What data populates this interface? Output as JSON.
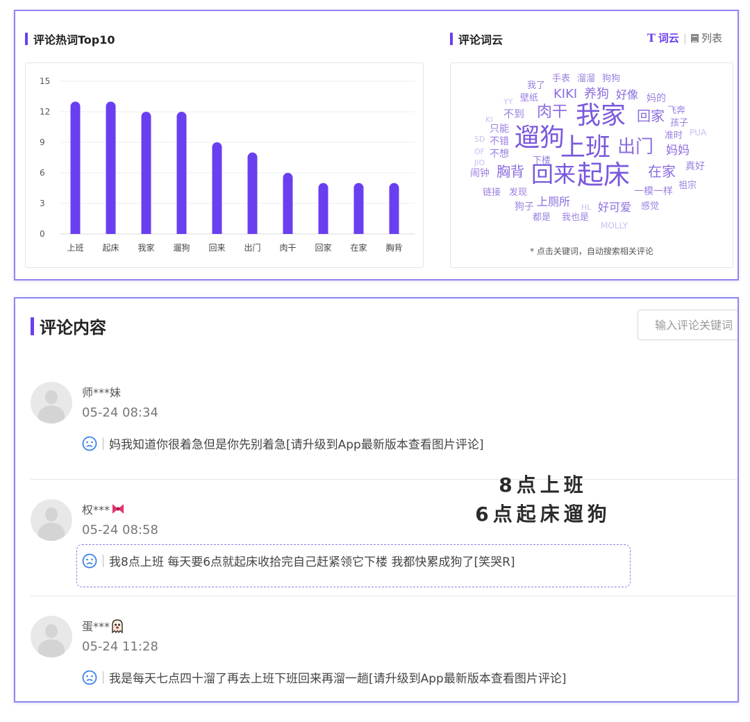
{
  "hot_words": {
    "title": "评论热词Top10"
  },
  "word_cloud": {
    "title": "评论词云",
    "toggle": {
      "cloud_label": "词云",
      "list_label": "列表"
    },
    "note": "* 点击关键词，自动搜索相关评论",
    "words": [
      {
        "text": "我了",
        "size": 13,
        "color": "#9b7fe0"
      },
      {
        "text": "手表",
        "size": 13,
        "color": "#9b7fe0"
      },
      {
        "text": "溜溜",
        "size": 13,
        "color": "#9b7fe0"
      },
      {
        "text": "狗狗",
        "size": 13,
        "color": "#9b7fe0"
      },
      {
        "text": "YY",
        "size": 11,
        "color": "#c9bff2"
      },
      {
        "text": "壁纸",
        "size": 13,
        "color": "#9b7fe0"
      },
      {
        "text": "KIKI",
        "size": 18,
        "color": "#8b6ce0"
      },
      {
        "text": "养狗",
        "size": 18,
        "color": "#8b6ce0"
      },
      {
        "text": "好像",
        "size": 16,
        "color": "#8b6ce0"
      },
      {
        "text": "妈的",
        "size": 14,
        "color": "#9b7fe0"
      },
      {
        "text": "不到",
        "size": 15,
        "color": "#9b7fe0"
      },
      {
        "text": "肉干",
        "size": 22,
        "color": "#8b6ce0"
      },
      {
        "text": "我家",
        "size": 36,
        "color": "#7a58dc"
      },
      {
        "text": "回家",
        "size": 20,
        "color": "#8b6ce0"
      },
      {
        "text": "飞奔",
        "size": 13,
        "color": "#9b7fe0"
      },
      {
        "text": "KI",
        "size": 11,
        "color": "#c9bff2"
      },
      {
        "text": "孩子",
        "size": 13,
        "color": "#9b7fe0"
      },
      {
        "text": "只能",
        "size": 14,
        "color": "#9b7fe0"
      },
      {
        "text": "准时",
        "size": 13,
        "color": "#9b7fe0"
      },
      {
        "text": "PUA",
        "size": 12,
        "color": "#c9bff2"
      },
      {
        "text": "SD",
        "size": 11,
        "color": "#c9bff2"
      },
      {
        "text": "不错",
        "size": 14,
        "color": "#9b7fe0"
      },
      {
        "text": "遛狗",
        "size": 36,
        "color": "#7a58dc"
      },
      {
        "text": "上班",
        "size": 36,
        "color": "#7a58dc"
      },
      {
        "text": "出门",
        "size": 26,
        "color": "#8b6ce0"
      },
      {
        "text": "OF",
        "size": 11,
        "color": "#c9bff2"
      },
      {
        "text": "不想",
        "size": 14,
        "color": "#9b7fe0"
      },
      {
        "text": "妈妈",
        "size": 17,
        "color": "#8b6ce0"
      },
      {
        "text": "下楼",
        "size": 13,
        "color": "#9b7fe0"
      },
      {
        "text": "JIO",
        "size": 11,
        "color": "#c9bff2"
      },
      {
        "text": "真好",
        "size": 14,
        "color": "#9b7fe0"
      },
      {
        "text": "闹钟",
        "size": 14,
        "color": "#9b7fe0"
      },
      {
        "text": "胸背",
        "size": 20,
        "color": "#8b6ce0"
      },
      {
        "text": "回来",
        "size": 32,
        "color": "#7a58dc"
      },
      {
        "text": "起床",
        "size": 38,
        "color": "#7a58dc"
      },
      {
        "text": "在家",
        "size": 20,
        "color": "#8b6ce0"
      },
      {
        "text": "一模一样",
        "size": 14,
        "color": "#9b7fe0"
      },
      {
        "text": "祖宗",
        "size": 13,
        "color": "#9b7fe0"
      },
      {
        "text": "链接",
        "size": 13,
        "color": "#9b7fe0"
      },
      {
        "text": "发现",
        "size": 13,
        "color": "#9b7fe0"
      },
      {
        "text": "狗子",
        "size": 14,
        "color": "#9b7fe0"
      },
      {
        "text": "上厕所",
        "size": 16,
        "color": "#8b6ce0"
      },
      {
        "text": "HL",
        "size": 11,
        "color": "#c9bff2"
      },
      {
        "text": "好可爱",
        "size": 16,
        "color": "#8b6ce0"
      },
      {
        "text": "感觉",
        "size": 13,
        "color": "#9b7fe0"
      },
      {
        "text": "都是",
        "size": 13,
        "color": "#9b7fe0"
      },
      {
        "text": "我也是",
        "size": 13,
        "color": "#9b7fe0"
      },
      {
        "text": "MOLLY",
        "size": 12,
        "color": "#c9bff2"
      }
    ]
  },
  "comments_section": {
    "title": "评论内容",
    "search_placeholder": "输入评论关键词",
    "comments": [
      {
        "user": "师***妹",
        "time": "05-24 08:34",
        "text": "妈我知道你很着急但是你先别着急[请升级到App最新版本查看图片评论]",
        "emoji": ""
      },
      {
        "user": "权***",
        "time": "05-24 08:58",
        "text": "我8点上班 每天要6点就起床收拾完自己赶紧领它下楼 我都快累成狗了[笑哭R]",
        "emoji": "bow-emoji"
      },
      {
        "user": "蛋***",
        "time": "05-24 11:28",
        "text": "我是每天七点四十溜了再去上班下班回来再溜一趟[请升级到App最新版本查看图片评论]",
        "emoji": "ghost-emoji"
      }
    ]
  },
  "overlay": {
    "line1": "8点上班",
    "line2": "6点起床遛狗"
  },
  "colors": {
    "accent": "#6a3ff0",
    "bar": "#6a3ff0",
    "panel_border": "#8f85ee"
  },
  "chart_data": {
    "type": "bar",
    "title": "评论热词Top10",
    "categories": [
      "上班",
      "起床",
      "我家",
      "遛狗",
      "回来",
      "出门",
      "肉干",
      "回家",
      "在家",
      "胸背"
    ],
    "values": [
      13,
      13,
      12,
      12,
      9,
      8,
      6,
      5,
      5,
      5
    ],
    "ylim": [
      0,
      15
    ],
    "yticks": [
      0,
      3,
      6,
      9,
      12,
      15
    ],
    "grid": true,
    "xlabel": "",
    "ylabel": ""
  }
}
